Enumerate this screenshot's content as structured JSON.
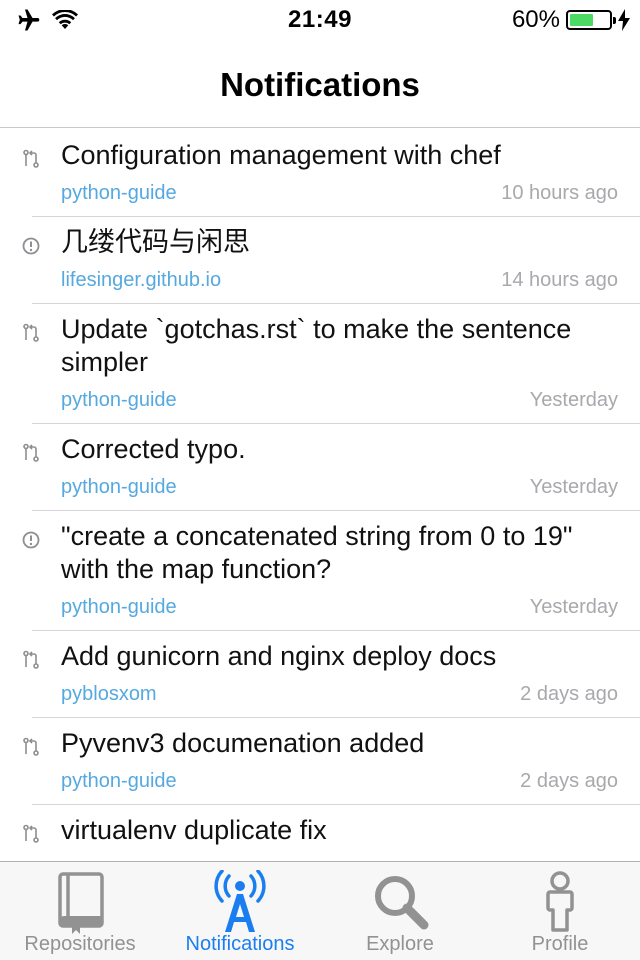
{
  "status_bar": {
    "time": "21:49",
    "battery": "60%",
    "battery_level": 0.6,
    "battery_color": "#4cd964"
  },
  "nav": {
    "title": "Notifications"
  },
  "notifications": [
    {
      "icon": "pull-request-icon",
      "title": "Configuration management with chef",
      "repo": "python-guide",
      "time": "10 hours ago"
    },
    {
      "icon": "issue-icon",
      "title": "几缕代码与闲思",
      "repo": "lifesinger.github.io",
      "time": "14 hours ago"
    },
    {
      "icon": "pull-request-icon",
      "title": "Update `gotchas.rst` to make the sentence simpler",
      "repo": "python-guide",
      "time": "Yesterday"
    },
    {
      "icon": "pull-request-icon",
      "title": "Corrected typo.",
      "repo": "python-guide",
      "time": "Yesterday"
    },
    {
      "icon": "issue-icon",
      "title": "\"create a concatenated string from 0 to 19\" with the map function?",
      "repo": "python-guide",
      "time": "Yesterday"
    },
    {
      "icon": "pull-request-icon",
      "title": "Add gunicorn and nginx deploy docs",
      "repo": "pyblosxom",
      "time": "2 days ago"
    },
    {
      "icon": "pull-request-icon",
      "title": "Pyvenv3 documenation added",
      "repo": "python-guide",
      "time": "2 days ago"
    },
    {
      "icon": "pull-request-icon",
      "title": "virtualenv duplicate fix",
      "repo": "",
      "time": ""
    }
  ],
  "tabs": [
    {
      "label": "Repositories",
      "icon": "book-icon",
      "active": false
    },
    {
      "label": "Notifications",
      "icon": "broadcast-icon",
      "active": true
    },
    {
      "label": "Explore",
      "icon": "magnifier-icon",
      "active": false
    },
    {
      "label": "Profile",
      "icon": "person-icon",
      "active": false
    }
  ],
  "colors": {
    "accent": "#1a7ef0",
    "repo_link": "#55a9e0",
    "timestamp": "#a8a8ad",
    "tab_inactive": "#929292"
  }
}
